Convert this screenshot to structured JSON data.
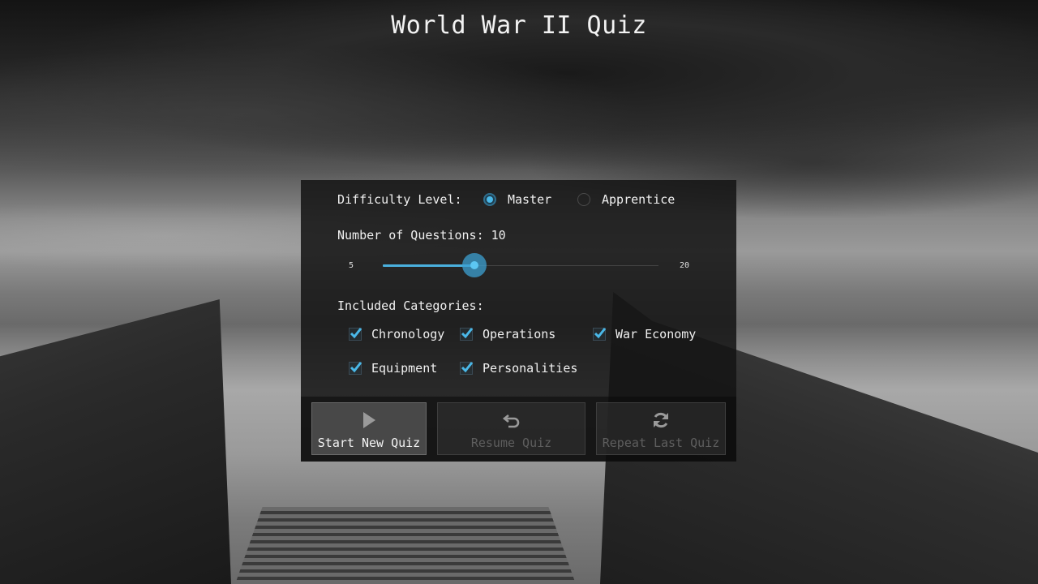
{
  "app": {
    "title": "World War II Quiz"
  },
  "difficulty": {
    "label": "Difficulty Level:",
    "options": [
      {
        "label": "Master",
        "selected": true
      },
      {
        "label": "Apprentice",
        "selected": false
      }
    ]
  },
  "questions": {
    "label": "Number of Questions: 10",
    "value": 10,
    "min": 5,
    "max": 20,
    "min_label": "5",
    "max_label": "20"
  },
  "categories": {
    "label": "Included Categories:",
    "items": [
      {
        "label": "Chronology",
        "checked": true
      },
      {
        "label": "Operations",
        "checked": true
      },
      {
        "label": "War Economy",
        "checked": true
      },
      {
        "label": "Equipment",
        "checked": true
      },
      {
        "label": "Personalities",
        "checked": true
      }
    ]
  },
  "buttons": {
    "start": {
      "label": "Start New Quiz",
      "icon": "play-icon",
      "enabled": true
    },
    "resume": {
      "label": "Resume Quiz",
      "icon": "undo-arrow-icon",
      "enabled": false
    },
    "repeat": {
      "label": "Repeat Last Quiz",
      "icon": "refresh-icon",
      "enabled": false
    }
  },
  "colors": {
    "accent": "#4ab8e8"
  }
}
